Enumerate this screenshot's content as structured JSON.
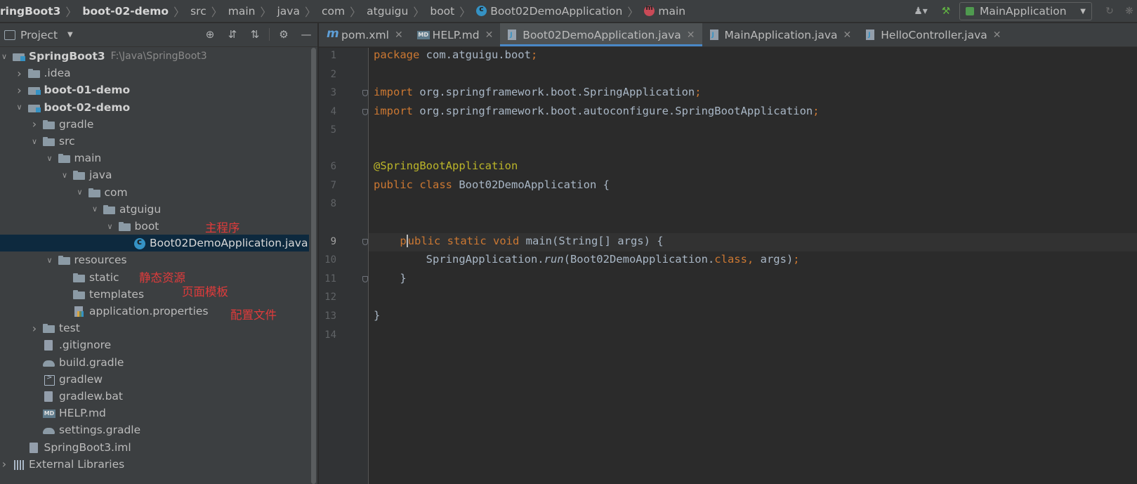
{
  "breadcrumb": {
    "items": [
      {
        "label": "ringBoot3",
        "bold": true
      },
      {
        "label": "boot-02-demo",
        "bold": true
      },
      {
        "label": "src"
      },
      {
        "label": "main"
      },
      {
        "label": "java"
      },
      {
        "label": "com"
      },
      {
        "label": "atguigu"
      },
      {
        "label": "boot"
      },
      {
        "label": "Boot02DemoApplication",
        "icon": "class-icon"
      },
      {
        "label": "main",
        "icon": "method-icon"
      }
    ]
  },
  "toolbar": {
    "run_config_label": "MainApplication",
    "icons": [
      "user-icon",
      "build-hammer-icon",
      "rerun-icon",
      "debug-icon"
    ]
  },
  "project_panel": {
    "title": "Project",
    "tool_icons": [
      "locate-icon",
      "expand-all-icon",
      "collapse-all-icon",
      "gear-icon",
      "minimize-icon"
    ],
    "tree": [
      {
        "label": "SpringBoot3",
        "hint": "F:\\Java\\SpringBoot3",
        "depth": 0,
        "arrow": "open",
        "icon": "module",
        "bold": true
      },
      {
        "label": ".idea",
        "depth": 1,
        "arrow": "closed",
        "icon": "folder"
      },
      {
        "label": "boot-01-demo",
        "depth": 1,
        "arrow": "closed",
        "icon": "module",
        "bold": true
      },
      {
        "label": "boot-02-demo",
        "depth": 1,
        "arrow": "open",
        "icon": "module",
        "bold": true
      },
      {
        "label": "gradle",
        "depth": 2,
        "arrow": "closed",
        "icon": "folder"
      },
      {
        "label": "src",
        "depth": 2,
        "arrow": "open",
        "icon": "folder"
      },
      {
        "label": "main",
        "depth": 3,
        "arrow": "open",
        "icon": "folder"
      },
      {
        "label": "java",
        "depth": 4,
        "arrow": "open",
        "icon": "folder"
      },
      {
        "label": "com",
        "depth": 5,
        "arrow": "open",
        "icon": "folder"
      },
      {
        "label": "atguigu",
        "depth": 6,
        "arrow": "open",
        "icon": "folder"
      },
      {
        "label": "boot",
        "depth": 7,
        "arrow": "open",
        "icon": "folder"
      },
      {
        "label": "Boot02DemoApplication.java",
        "depth": 8,
        "arrow": "none",
        "icon": "java",
        "selected": true
      },
      {
        "label": "resources",
        "depth": 3,
        "arrow": "open",
        "icon": "folder"
      },
      {
        "label": "static",
        "depth": 4,
        "arrow": "none",
        "icon": "folder"
      },
      {
        "label": "templates",
        "depth": 4,
        "arrow": "none",
        "icon": "folder"
      },
      {
        "label": "application.properties",
        "depth": 4,
        "arrow": "none",
        "icon": "props"
      },
      {
        "label": "test",
        "depth": 2,
        "arrow": "closed",
        "icon": "folder"
      },
      {
        "label": ".gitignore",
        "depth": 2,
        "arrow": "none",
        "icon": "file"
      },
      {
        "label": "build.gradle",
        "depth": 2,
        "arrow": "none",
        "icon": "gradle"
      },
      {
        "label": "gradlew",
        "depth": 2,
        "arrow": "none",
        "icon": "term"
      },
      {
        "label": "gradlew.bat",
        "depth": 2,
        "arrow": "none",
        "icon": "file"
      },
      {
        "label": "HELP.md",
        "depth": 2,
        "arrow": "none",
        "icon": "md"
      },
      {
        "label": "settings.gradle",
        "depth": 2,
        "arrow": "none",
        "icon": "gradle"
      },
      {
        "label": "SpringBoot3.iml",
        "depth": 1,
        "arrow": "none",
        "icon": "file"
      },
      {
        "label": "External Libraries",
        "depth": 0,
        "arrow": "closed",
        "icon": "libs"
      }
    ]
  },
  "annotations": {
    "main_program": "主程序",
    "static_resources": "静态资源",
    "page_templates": "页面模板",
    "config_file": "配置文件",
    "color": "#e03b3b"
  },
  "tabs": [
    {
      "label": "pom.xml",
      "icon": "m"
    },
    {
      "label": "HELP.md",
      "icon": "md"
    },
    {
      "label": "Boot02DemoApplication.java",
      "icon": "j",
      "active": true
    },
    {
      "label": "MainApplication.java",
      "icon": "j"
    },
    {
      "label": "HelloController.java",
      "icon": "j"
    }
  ],
  "editor": {
    "lines": [
      {
        "n": "1",
        "tokens": [
          [
            "kw",
            "package "
          ],
          [
            "",
            "com.atguigu.boot"
          ],
          [
            "kw",
            ";"
          ]
        ]
      },
      {
        "n": "2",
        "tokens": []
      },
      {
        "n": "3",
        "fold": true,
        "tokens": [
          [
            "kw",
            "import "
          ],
          [
            "",
            "org.springframework.boot.SpringApplication"
          ],
          [
            "kw",
            ";"
          ]
        ]
      },
      {
        "n": "4",
        "fold": true,
        "tokens": [
          [
            "kw",
            "import "
          ],
          [
            "",
            "org.springframework.boot.autoconfigure.SpringBootApplication"
          ],
          [
            "kw",
            ";"
          ]
        ]
      },
      {
        "n": "5",
        "tokens": []
      },
      {
        "n": "6",
        "tokens": [
          [
            "ann",
            "@SpringBootApplication"
          ]
        ]
      },
      {
        "n": "7",
        "tokens": [
          [
            "kw",
            "public class "
          ],
          [
            "",
            "Boot02DemoApplication {"
          ]
        ]
      },
      {
        "n": "8",
        "tokens": []
      },
      {
        "n": "9",
        "fold": true,
        "current": true,
        "tokens": [
          [
            "",
            "    "
          ],
          [
            "kw",
            "p"
          ],
          [
            "caret",
            ""
          ],
          [
            "kw",
            "ublic static void "
          ],
          [
            "",
            "main(String[] args) {"
          ]
        ]
      },
      {
        "n": "10",
        "tokens": [
          [
            "",
            "        SpringApplication."
          ],
          [
            "it",
            "run"
          ],
          [
            "",
            "(Boot02DemoApplication."
          ],
          [
            "kw",
            "class"
          ],
          [
            "kw",
            ", "
          ],
          [
            "",
            "args)"
          ],
          [
            "kw",
            ";"
          ]
        ]
      },
      {
        "n": "11",
        "fold": true,
        "tokens": [
          [
            "",
            "    }"
          ]
        ]
      },
      {
        "n": "12",
        "tokens": []
      },
      {
        "n": "13",
        "tokens": [
          [
            "",
            "}"
          ]
        ]
      },
      {
        "n": "14",
        "tokens": []
      }
    ]
  },
  "colors": {
    "accent": "#4a88c7",
    "keyword": "#cc7832",
    "annotation": "#bbb529",
    "text": "#a9b7c6"
  }
}
